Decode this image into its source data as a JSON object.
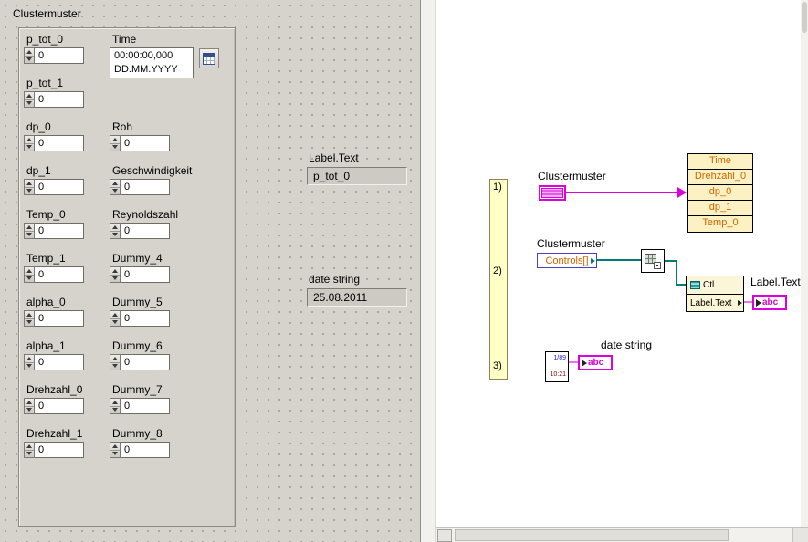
{
  "front_panel": {
    "panel_label": "Clustermuster",
    "left_controls": [
      {
        "label": "p_tot_0",
        "value": "0"
      },
      {
        "label": "p_tot_1",
        "value": "0"
      },
      {
        "label": "dp_0",
        "value": "0"
      },
      {
        "label": "dp_1",
        "value": "0"
      },
      {
        "label": "Temp_0",
        "value": "0"
      },
      {
        "label": "Temp_1",
        "value": "0"
      },
      {
        "label": "alpha_0",
        "value": "0"
      },
      {
        "label": "alpha_1",
        "value": "0"
      },
      {
        "label": "Drehzahl_0",
        "value": "0"
      },
      {
        "label": "Drehzahl_1",
        "value": "0"
      }
    ],
    "time_control": {
      "label": "Time",
      "time_value": "00:00:00,000",
      "date_value": "DD.MM.YYYY"
    },
    "right_controls": [
      {
        "label": "Roh",
        "value": "0"
      },
      {
        "label": "Geschwindigkeit",
        "value": "0"
      },
      {
        "label": "Reynoldszahl",
        "value": "0"
      },
      {
        "label": "Dummy_4",
        "value": "0"
      },
      {
        "label": "Dummy_5",
        "value": "0"
      },
      {
        "label": "Dummy_6",
        "value": "0"
      },
      {
        "label": "Dummy_7",
        "value": "0"
      },
      {
        "label": "Dummy_8",
        "value": "0"
      }
    ],
    "indicators": {
      "label_text": {
        "label": "Label.Text",
        "value": "p_tot_0"
      },
      "date_string": {
        "label": "date string",
        "value": "25.08.2011"
      }
    }
  },
  "block_diagram": {
    "frame_labels": [
      "1)",
      "2)",
      "3)"
    ],
    "cluster1_label": "Clustermuster",
    "unbundle_rows": [
      "Time",
      "Drehzahl_0",
      "dp_0",
      "dp_1",
      "Temp_0"
    ],
    "cluster2_label": "Clustermuster",
    "controls_property": "Controls[]",
    "property_node_rows": [
      "Ctl",
      "Label.Text"
    ],
    "output_label": "Label.Text",
    "string_glyph": "abc",
    "date_label": "date string",
    "date_icon": {
      "line1": "1/89",
      "line2": "10:21"
    }
  },
  "colors": {
    "cluster_wire": "#dc00dc",
    "reference_wire": "#007a7a",
    "string_wire": "#ee6eee",
    "node_text": "#d06500",
    "panel_background": "#d6d3cd"
  }
}
